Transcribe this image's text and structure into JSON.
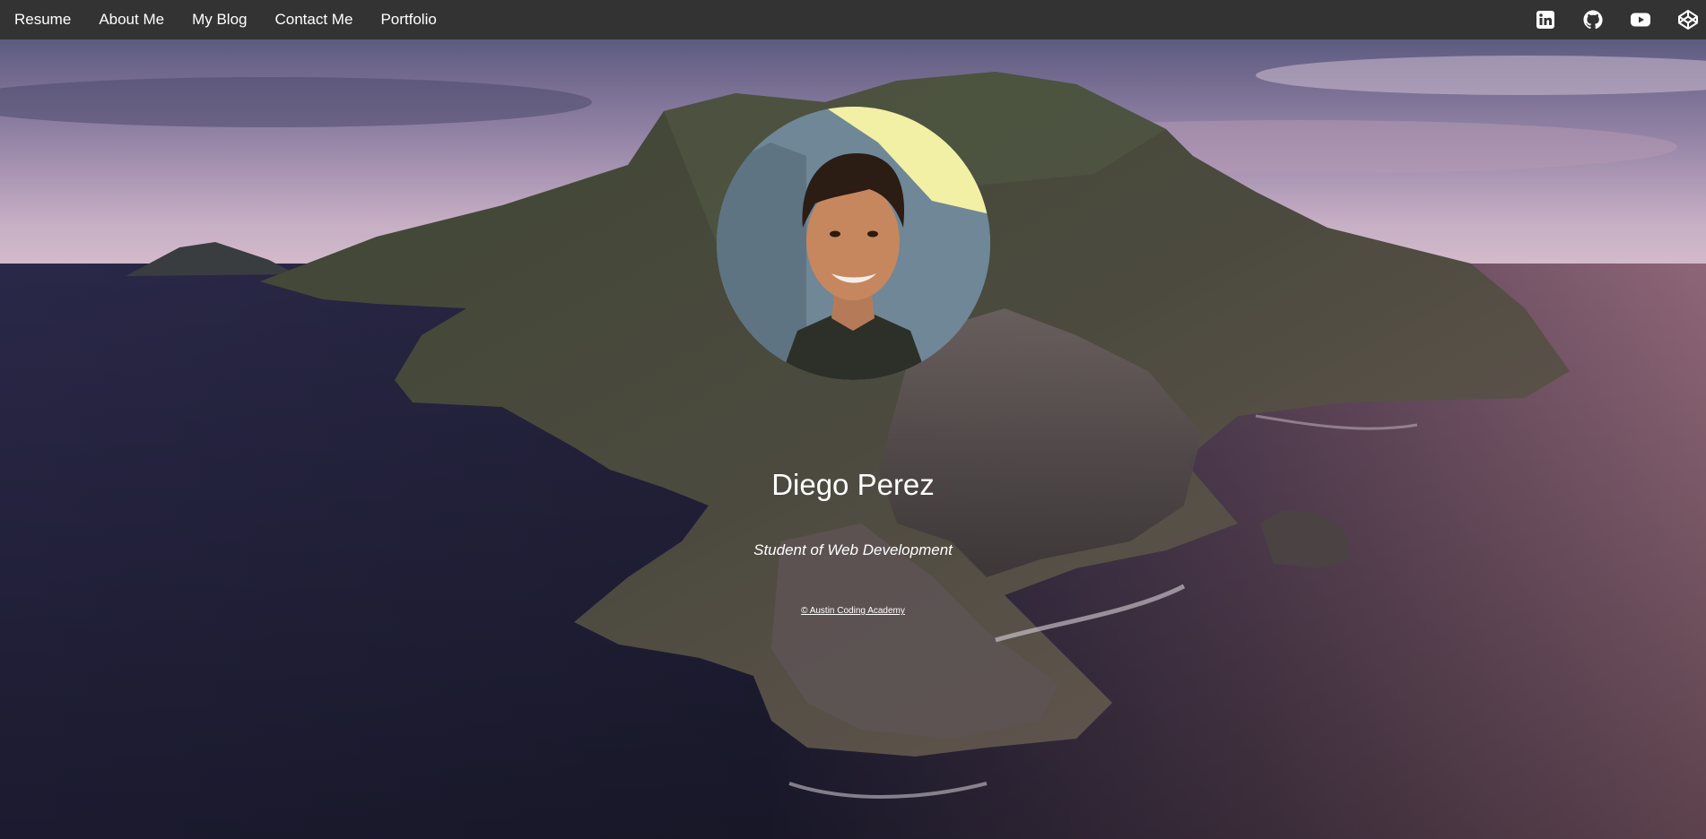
{
  "nav": {
    "links": [
      {
        "label": "Resume"
      },
      {
        "label": "About Me"
      },
      {
        "label": "My Blog"
      },
      {
        "label": "Contact Me"
      },
      {
        "label": "Portfolio"
      }
    ],
    "icons": [
      "linkedin-icon",
      "github-icon",
      "youtube-icon",
      "codepen-icon"
    ]
  },
  "profile": {
    "name": "Diego Perez",
    "tagline": "Student of Web Development",
    "copyright": "© Austin Coding Academy"
  },
  "colors": {
    "navbar": "#333333",
    "text": "#ffffff"
  }
}
